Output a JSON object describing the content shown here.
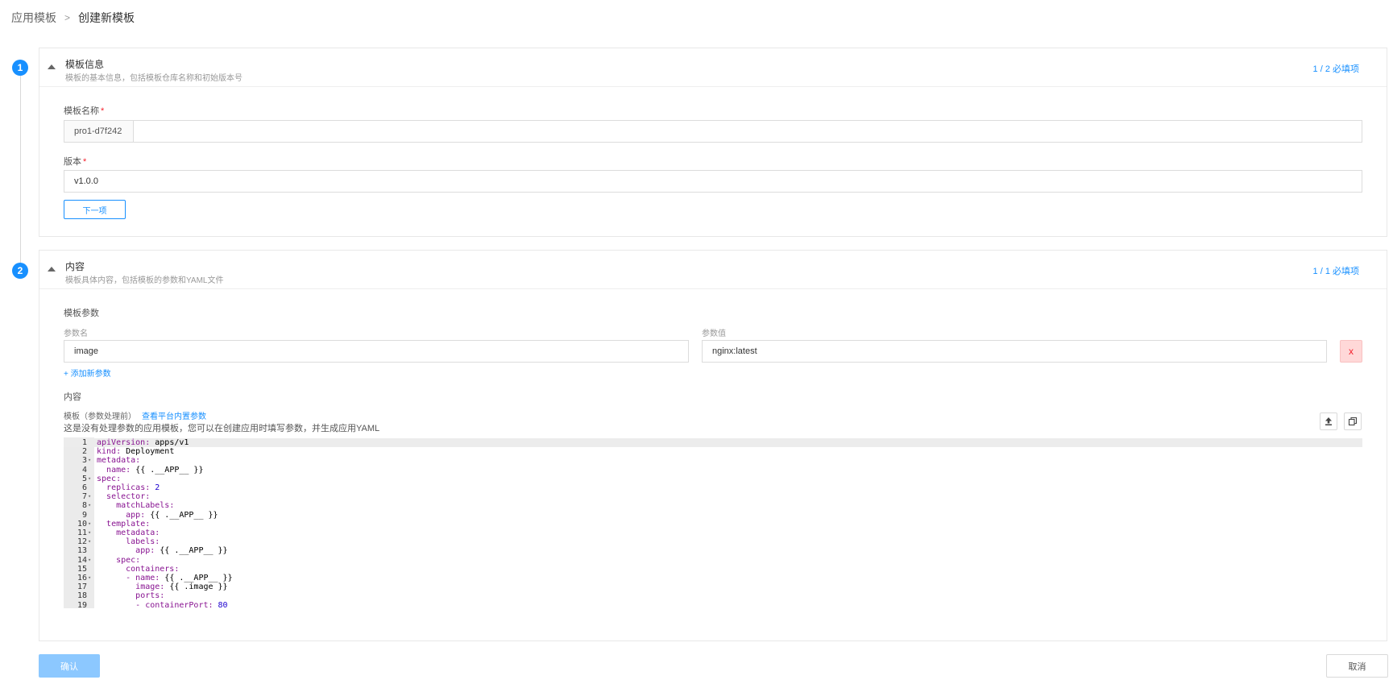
{
  "breadcrumb": {
    "parent": "应用模板",
    "separator": ">",
    "current": "创建新模板"
  },
  "steps": [
    {
      "number": "1",
      "title": "模板信息",
      "desc": "模板的基本信息，包括模板仓库名称和初始版本号",
      "required": "1 / 2 必填项"
    },
    {
      "number": "2",
      "title": "内容",
      "desc": "模板具体内容，包括模板的参数和YAML文件",
      "required": "1 / 1 必填项"
    }
  ],
  "form": {
    "name_label": "模板名称",
    "name_prefix": "pro1-d7f242",
    "name_value": "",
    "version_label": "版本",
    "version_value": "v1.0.0",
    "next_button": "下一项",
    "required_mark": "*"
  },
  "params": {
    "section_label": "模板参数",
    "name_col": "参数名",
    "value_col": "参数值",
    "rows": [
      {
        "name": "image",
        "value": "nginx:latest",
        "delete": "x"
      }
    ],
    "add_link": "+ 添加新参数"
  },
  "content": {
    "section_label": "内容",
    "template_label": "模板（参数处理前）",
    "builtin_link": "查看平台内置参数",
    "hint": "这是没有处理参数的应用模板，您可以在创建应用时填写参数，并生成应用YAML",
    "upload_icon": "upload-icon",
    "copy_icon": "copy-icon"
  },
  "code_lines": [
    {
      "n": "1",
      "fold": false,
      "indent": "",
      "key": "apiVersion:",
      "val": " apps/v1",
      "num": ""
    },
    {
      "n": "2",
      "fold": false,
      "indent": "",
      "key": "kind:",
      "val": " Deployment",
      "num": ""
    },
    {
      "n": "3",
      "fold": true,
      "indent": "",
      "key": "metadata:",
      "val": "",
      "num": ""
    },
    {
      "n": "4",
      "fold": false,
      "indent": "  ",
      "key": "name:",
      "val": " {{ .__APP__ }}",
      "num": ""
    },
    {
      "n": "5",
      "fold": true,
      "indent": "",
      "key": "spec:",
      "val": "",
      "num": ""
    },
    {
      "n": "6",
      "fold": false,
      "indent": "  ",
      "key": "replicas:",
      "val": " ",
      "num": "2"
    },
    {
      "n": "7",
      "fold": true,
      "indent": "  ",
      "key": "selector:",
      "val": "",
      "num": ""
    },
    {
      "n": "8",
      "fold": true,
      "indent": "    ",
      "key": "matchLabels:",
      "val": "",
      "num": ""
    },
    {
      "n": "9",
      "fold": false,
      "indent": "      ",
      "key": "app:",
      "val": " {{ .__APP__ }}",
      "num": ""
    },
    {
      "n": "10",
      "fold": true,
      "indent": "  ",
      "key": "template:",
      "val": "",
      "num": ""
    },
    {
      "n": "11",
      "fold": true,
      "indent": "    ",
      "key": "metadata:",
      "val": "",
      "num": ""
    },
    {
      "n": "12",
      "fold": true,
      "indent": "      ",
      "key": "labels:",
      "val": "",
      "num": ""
    },
    {
      "n": "13",
      "fold": false,
      "indent": "        ",
      "key": "app:",
      "val": " {{ .__APP__ }}",
      "num": ""
    },
    {
      "n": "14",
      "fold": true,
      "indent": "    ",
      "key": "spec:",
      "val": "",
      "num": ""
    },
    {
      "n": "15",
      "fold": false,
      "indent": "      ",
      "key": "containers:",
      "val": "",
      "num": ""
    },
    {
      "n": "16",
      "fold": true,
      "indent": "      ",
      "key": "- name:",
      "val": " {{ .__APP__ }}",
      "num": ""
    },
    {
      "n": "17",
      "fold": false,
      "indent": "        ",
      "key": "image:",
      "val": " {{ .image }}",
      "num": ""
    },
    {
      "n": "18",
      "fold": false,
      "indent": "        ",
      "key": "ports:",
      "val": "",
      "num": ""
    },
    {
      "n": "19",
      "fold": false,
      "indent": "        ",
      "key": "- containerPort:",
      "val": " ",
      "num": "80"
    }
  ],
  "footer": {
    "confirm": "确认",
    "cancel": "取消"
  }
}
